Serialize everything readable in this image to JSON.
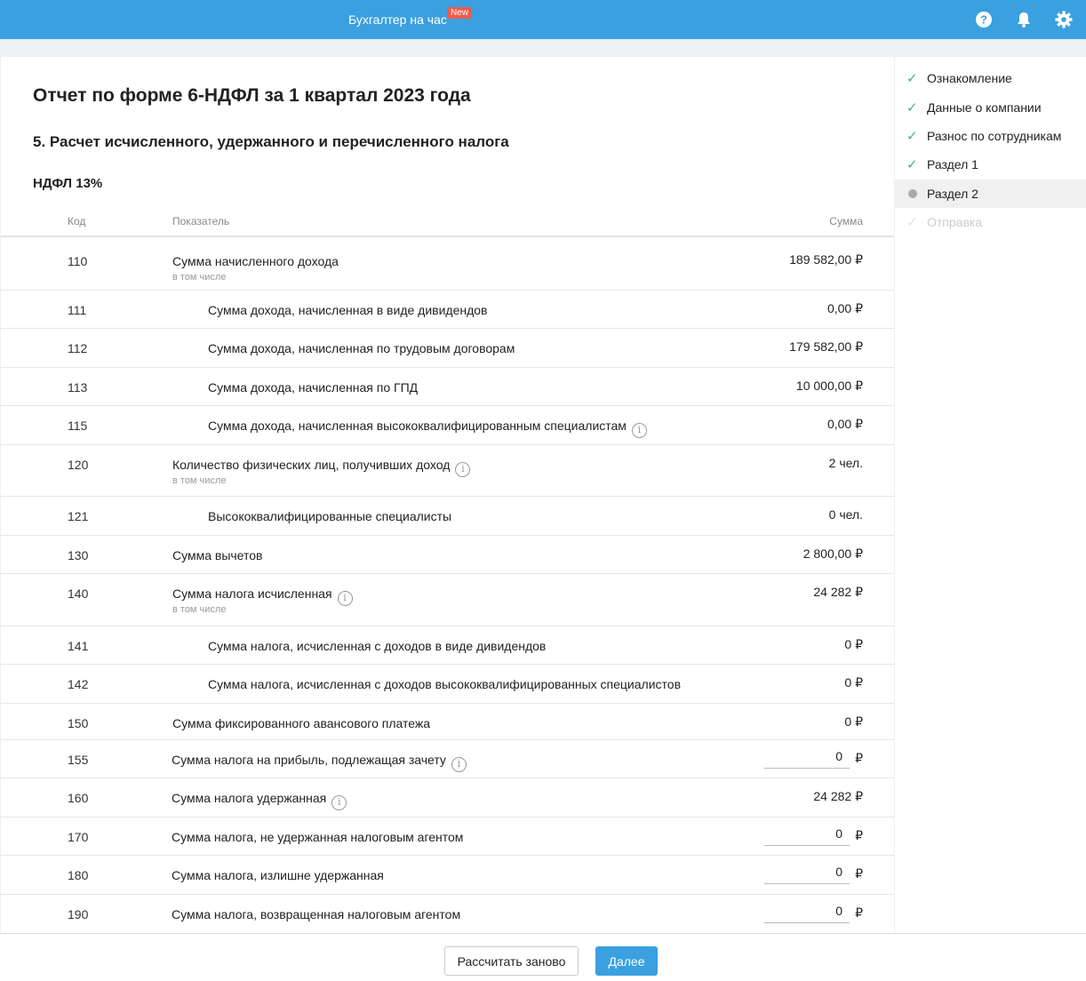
{
  "topbar": {
    "title": "Бухгалтер на час",
    "badge": "New",
    "icons": [
      "help-icon",
      "bell-icon",
      "gear-icon"
    ]
  },
  "report": {
    "title": "Отчет по форме 6-НДФЛ за 1 квартал 2023 года",
    "section": "5. Расчет исчисленного, удержанного и перечисленного налога",
    "subsection": "НДФЛ 13%"
  },
  "table": {
    "headers": {
      "code": "Код",
      "name": "Показатель",
      "sum": "Сумма"
    },
    "rows": [
      {
        "code": "110",
        "name": "Сумма начисленного дохода",
        "sub": "в том числе",
        "value": "189 582,00 ₽"
      },
      {
        "code": "111",
        "name": "Сумма дохода, начисленная в виде дивидендов",
        "value": "0,00 ₽"
      },
      {
        "code": "112",
        "name": "Сумма дохода, начисленная по трудовым договорам",
        "value": "179 582,00 ₽"
      },
      {
        "code": "113",
        "name": "Сумма дохода, начисленная по ГПД",
        "value": "10 000,00 ₽"
      },
      {
        "code": "115",
        "name": "Сумма дохода, начисленная высококвалифицированным специалистам",
        "value": "0,00 ₽"
      },
      {
        "code": "120",
        "name": "Количество физических лиц, получивших доход",
        "sub": "в том числе",
        "value": "2 чел."
      },
      {
        "code": "121",
        "name": "Высококвалифицированные специалисты",
        "value": "0 чел."
      },
      {
        "code": "130",
        "name": "Сумма вычетов",
        "value": "2 800,00 ₽"
      },
      {
        "code": "140",
        "name": "Сумма налога исчисленная",
        "sub": "в том числе",
        "value": "24 282 ₽"
      },
      {
        "code": "141",
        "name": "Сумма налога, исчисленная с доходов в виде дивидендов",
        "value": "0 ₽"
      },
      {
        "code": "142",
        "name": "Сумма налога, исчисленная с доходов высококвалифицированных специалистов",
        "value": "0 ₽"
      },
      {
        "code": "150",
        "name": "Сумма фиксированного авансового платежа",
        "value": "0 ₽"
      },
      {
        "code": "155",
        "name": "Сумма налога на прибыль, подлежащая зачету",
        "value": "0",
        "currency": "₽"
      },
      {
        "code": "160",
        "name": "Сумма налога удержанная",
        "value": "24 282 ₽"
      },
      {
        "code": "170",
        "name": "Сумма налога, не удержанная налоговым агентом",
        "value": "0",
        "currency": "₽"
      },
      {
        "code": "180",
        "name": "Сумма налога, излишне удержанная",
        "value": "0",
        "currency": "₽"
      },
      {
        "code": "190",
        "name": "Сумма налога, возвращенная налоговым агентом",
        "value": "0",
        "currency": "₽"
      }
    ]
  },
  "steps": [
    {
      "label": "Ознакомление",
      "state": "done"
    },
    {
      "label": "Данные о компании",
      "state": "done"
    },
    {
      "label": "Разнос по сотрудникам",
      "state": "done"
    },
    {
      "label": "Раздел 1",
      "state": "done"
    },
    {
      "label": "Раздел 2",
      "state": "current"
    },
    {
      "label": "Отправка",
      "state": "disabled"
    }
  ],
  "footer": {
    "recalc_label": "Рассчитать заново",
    "next_label": "Далее"
  },
  "colors": {
    "accent": "#3aa0e0",
    "badge": "#f05a4a",
    "check": "#3fb571"
  }
}
